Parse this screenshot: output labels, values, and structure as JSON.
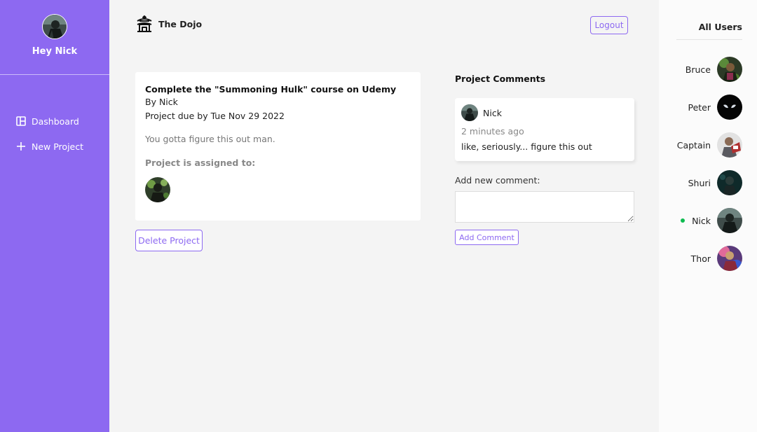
{
  "sidebar": {
    "greeting": "Hey Nick",
    "nav": [
      {
        "label": "Dashboard",
        "icon": "dashboard-icon"
      },
      {
        "label": "New Project",
        "icon": "add-icon"
      }
    ]
  },
  "header": {
    "title": "The Dojo",
    "logo_icon": "temple-icon",
    "logout_label": "Logout"
  },
  "project": {
    "name": "Complete the \"Summoning Hulk\" course on Udemy",
    "by": "By Nick",
    "due": "Project due by Tue Nov 29 2022",
    "details": "You gotta figure this out man.",
    "assigned_label": "Project is assigned to:",
    "delete_label": "Delete Project"
  },
  "comments": {
    "heading": "Project Comments",
    "items": [
      {
        "author": "Nick",
        "date": "2 minutes ago",
        "content": "like, seriously... figure this out"
      }
    ],
    "add_label": "Add new comment:",
    "input_value": "",
    "add_button_label": "Add Comment"
  },
  "users": {
    "heading": "All Users",
    "list": [
      {
        "name": "Bruce",
        "online": false
      },
      {
        "name": "Peter",
        "online": false
      },
      {
        "name": "Captain",
        "online": false
      },
      {
        "name": "Shuri",
        "online": false
      },
      {
        "name": "Nick",
        "online": true
      },
      {
        "name": "Thor",
        "online": false
      }
    ]
  },
  "colors": {
    "primary": "#8d69f1",
    "background": "#f4f4f4",
    "online": "#0ebb50"
  }
}
